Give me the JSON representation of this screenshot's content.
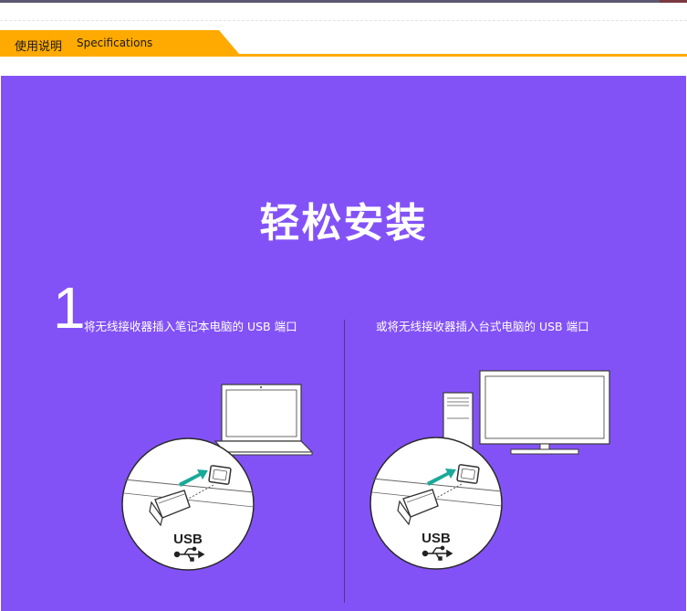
{
  "header": {
    "tab_cn": "使用说明",
    "tab_en": "Specifications",
    "accent_color": "#ffaa00"
  },
  "panel": {
    "background": "#8352f7",
    "title": "轻松安装",
    "step_number": "1",
    "left_caption": "将无线接收器插入笔记本电脑的 USB 端口",
    "right_caption": "或将无线接收器插入台式电脑的 USB 端口",
    "usb_label": "USB",
    "arrow_color": "#1aa999",
    "icons": [
      "laptop-icon",
      "desktop-monitor-icon",
      "desktop-tower-icon",
      "usb-receiver-icon",
      "usb-symbol-icon",
      "insert-arrow-icon"
    ]
  }
}
